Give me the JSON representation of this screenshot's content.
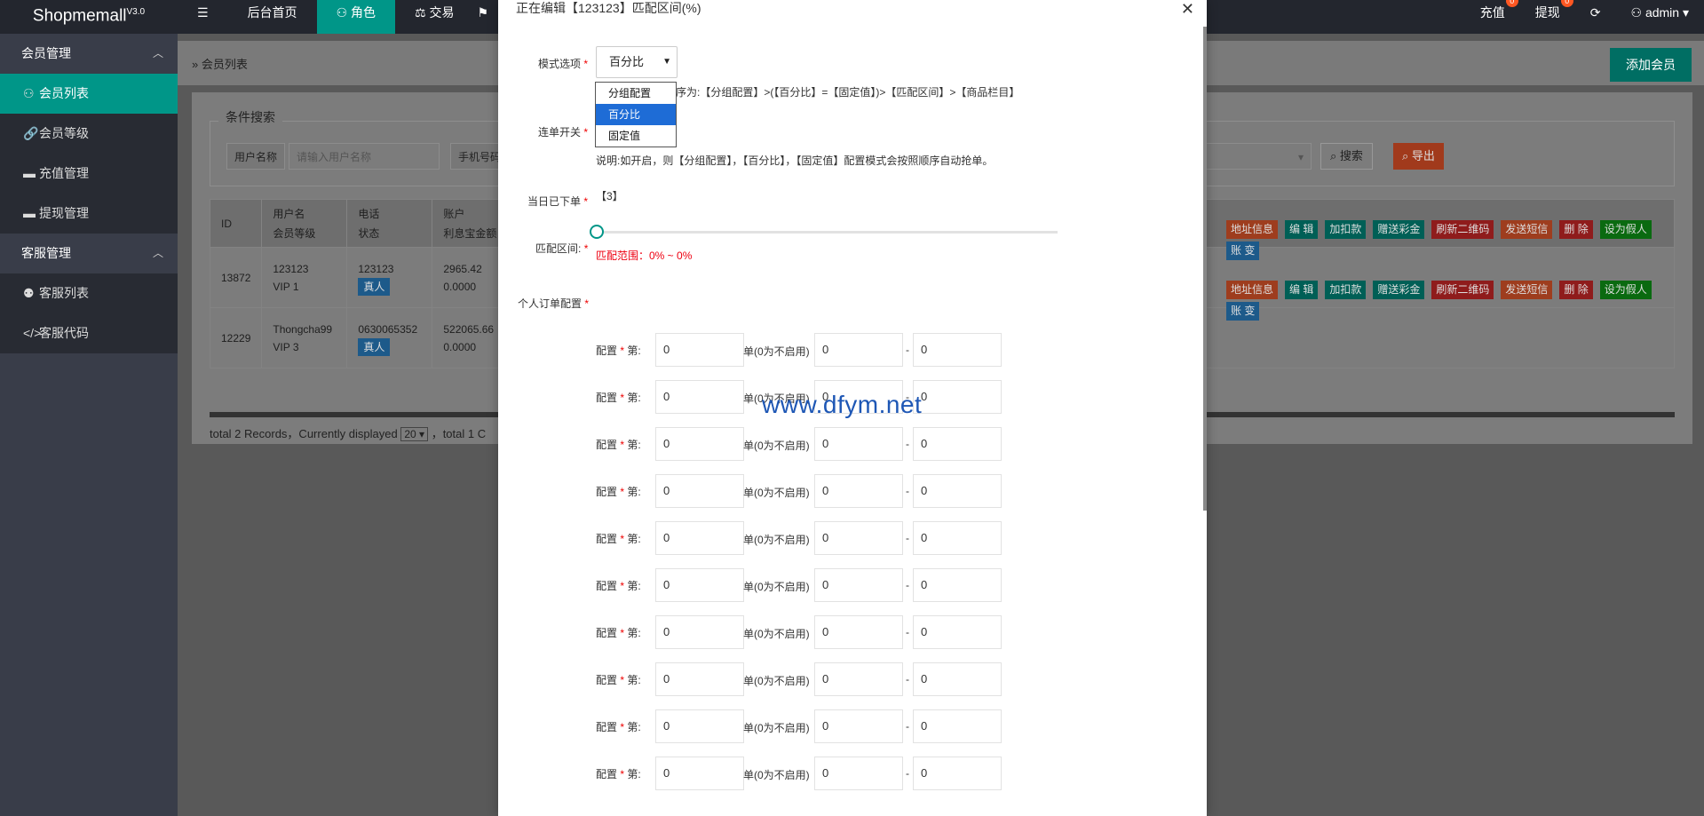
{
  "topbar": {
    "logo": "Shopmemall",
    "version": "V3.0",
    "nav": [
      {
        "label": "☰"
      },
      {
        "label": "后台首页"
      },
      {
        "label": "角色"
      },
      {
        "label": "交易"
      },
      {
        "label": "⚑"
      }
    ],
    "right": [
      {
        "label": "充值",
        "badge": "0"
      },
      {
        "label": "提现",
        "badge": "0"
      },
      {
        "label": "⟳",
        "badge": ""
      },
      {
        "label": "admin ▾",
        "badge": ""
      }
    ]
  },
  "sidebar": {
    "group1": "会员管理",
    "items1": [
      "会员列表",
      "会员等级",
      "充值管理",
      "提现管理"
    ],
    "group2": "客服管理",
    "items2": [
      "客服列表",
      "客服代码"
    ]
  },
  "main": {
    "breadcrumb": "» 会员列表",
    "add_button": "添加会员",
    "search": {
      "legend": "条件搜索",
      "username_label": "用户名称",
      "username_placeholder": "请输入用户名称",
      "phone_label": "手机号码",
      "search_button": "搜索",
      "export_button": "导出"
    },
    "table": {
      "headers": [
        "ID",
        "用户名",
        "会员等级",
        "电话",
        "状态",
        "账户",
        "利息宝金额"
      ],
      "rows": [
        {
          "id": "13872",
          "username": "123123",
          "level": "VIP 1",
          "phone": "123123",
          "status": "真人",
          "balance": "2965.42",
          "interest": "0.0000"
        },
        {
          "id": "12229",
          "username": "Thongcha99",
          "level": "VIP 3",
          "phone": "0630065352",
          "status": "真人",
          "balance": "522065.66",
          "interest": "0.0000"
        }
      ],
      "ops": [
        "地址信息",
        "编 辑",
        "加扣款",
        "赠送彩金",
        "刷新二维码",
        "发送短信",
        "删 除",
        "设为假人"
      ],
      "ops2": [
        "账 变"
      ]
    },
    "footer": {
      "text1": "total 2 Records，Currently displayed",
      "page_size": "20",
      "text2": "，total 1 C"
    }
  },
  "modal": {
    "title": "正在编辑【123123】匹配区间(%)",
    "close": "✕",
    "mode_label": "模式选项",
    "mode_value": "百分比",
    "mode_options": [
      "分组配置",
      "百分比",
      "固定值"
    ],
    "mode_note": "序为:【分组配置】>(【百分比】=【固定值】)>【匹配区间】>【商品栏目】",
    "switch_label": "连单开关",
    "switch_note": "说明:如开启，则【分组配置】，【百分比】，【固定值】配置模式会按照顺序自动抢单。",
    "today_label": "当日已下单",
    "today_value": "【3】",
    "range_label": "匹配区间:",
    "range_text": "匹配范围：0% ~ 0%",
    "personal_label": "个人订单配置",
    "config_rows": [
      {
        "label": "配置",
        "suffix": "第:",
        "first": "0",
        "unit": "单(0为不启用)",
        "min": "0",
        "max": "0"
      },
      {
        "label": "配置",
        "suffix": "第:",
        "first": "0",
        "unit": "单(0为不启用)",
        "min": "0",
        "max": "0"
      },
      {
        "label": "配置",
        "suffix": "第:",
        "first": "0",
        "unit": "单(0为不启用)",
        "min": "0",
        "max": "0"
      },
      {
        "label": "配置",
        "suffix": "第:",
        "first": "0",
        "unit": "单(0为不启用)",
        "min": "0",
        "max": "0"
      },
      {
        "label": "配置",
        "suffix": "第:",
        "first": "0",
        "unit": "单(0为不启用)",
        "min": "0",
        "max": "0"
      },
      {
        "label": "配置",
        "suffix": "第:",
        "first": "0",
        "unit": "单(0为不启用)",
        "min": "0",
        "max": "0"
      },
      {
        "label": "配置",
        "suffix": "第:",
        "first": "0",
        "unit": "单(0为不启用)",
        "min": "0",
        "max": "0"
      },
      {
        "label": "配置",
        "suffix": "第:",
        "first": "0",
        "unit": "单(0为不启用)",
        "min": "0",
        "max": "0"
      },
      {
        "label": "配置",
        "suffix": "第:",
        "first": "0",
        "unit": "单(0为不启用)",
        "min": "0",
        "max": "0"
      },
      {
        "label": "配置",
        "suffix": "第:",
        "first": "0",
        "unit": "单(0为不启用)",
        "min": "0",
        "max": "0"
      }
    ],
    "dash": "-"
  },
  "watermark": "www.dfym.net"
}
